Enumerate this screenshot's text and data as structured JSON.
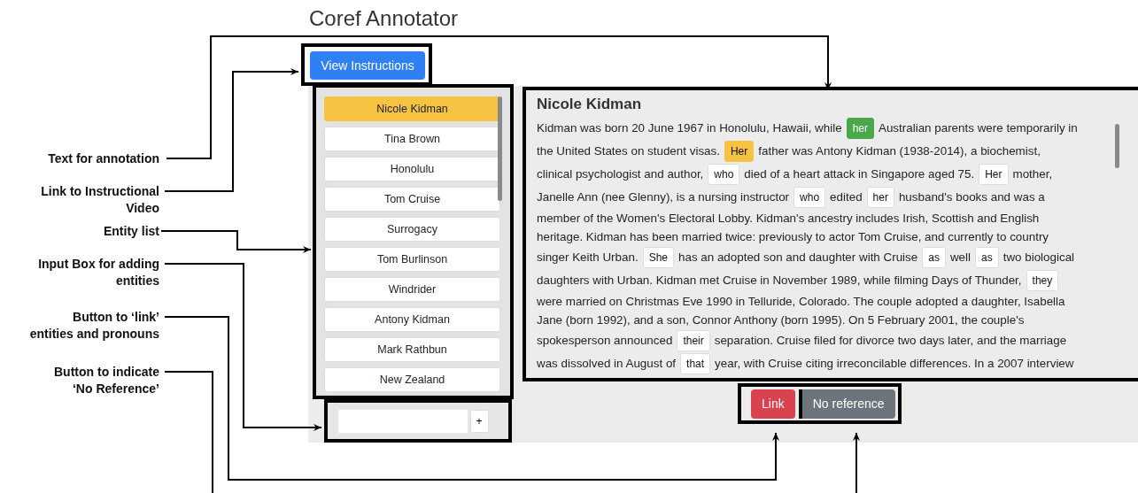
{
  "title": "Coref Annotator",
  "instructions_button": "View Instructions",
  "entities": [
    {
      "name": "Nicole Kidman",
      "selected": true
    },
    {
      "name": "Tina Brown",
      "selected": false
    },
    {
      "name": "Honolulu",
      "selected": false
    },
    {
      "name": "Tom Cruise",
      "selected": false
    },
    {
      "name": "Surrogacy",
      "selected": false
    },
    {
      "name": "Tom Burlinson",
      "selected": false
    },
    {
      "name": "Windrider",
      "selected": false
    },
    {
      "name": "Antony Kidman",
      "selected": false
    },
    {
      "name": "Mark Rathbun",
      "selected": false
    },
    {
      "name": "New Zealand",
      "selected": false
    }
  ],
  "add_entity": {
    "button": "+"
  },
  "passage": {
    "heading": "Nicole Kidman",
    "lines": [
      [
        {
          "kind": "text",
          "text": "Kidman was born 20 June 1967 in Honolulu, Hawaii, while"
        },
        {
          "kind": "token",
          "text": "her",
          "linked": true,
          "selected": false
        },
        {
          "kind": "text",
          "text": "Australian parents were temporarily in"
        }
      ],
      [
        {
          "kind": "text",
          "text": "the United States on student visas."
        },
        {
          "kind": "token",
          "text": "Her",
          "linked": false,
          "selected": true
        },
        {
          "kind": "text",
          "text": "father was Antony Kidman (1938-2014), a biochemist,"
        }
      ],
      [
        {
          "kind": "text",
          "text": "clinical psychologist and author,"
        },
        {
          "kind": "token",
          "text": "who",
          "linked": false,
          "selected": false
        },
        {
          "kind": "text",
          "text": "died of a heart attack in Singapore aged 75."
        },
        {
          "kind": "token",
          "text": "Her",
          "linked": false,
          "selected": false
        },
        {
          "kind": "text",
          "text": "mother,"
        }
      ],
      [
        {
          "kind": "text",
          "text": "Janelle Ann (nee Glenny), is a nursing instructor"
        },
        {
          "kind": "token",
          "text": "who",
          "linked": false,
          "selected": false
        },
        {
          "kind": "text",
          "text": "edited"
        },
        {
          "kind": "token",
          "text": "her",
          "linked": false,
          "selected": false
        },
        {
          "kind": "text",
          "text": "husband's books and was a"
        }
      ],
      [
        {
          "kind": "text",
          "text": "member of the Women's Electoral Lobby. Kidman's ancestry includes Irish, Scottish and English"
        }
      ],
      [
        {
          "kind": "text",
          "text": "heritage. Kidman has been married twice: previously to actor Tom Cruise, and currently to country"
        }
      ],
      [
        {
          "kind": "text",
          "text": "singer Keith Urban."
        },
        {
          "kind": "token",
          "text": "She",
          "linked": false,
          "selected": false
        },
        {
          "kind": "text",
          "text": "has an adopted son and daughter with Cruise"
        },
        {
          "kind": "token",
          "text": "as",
          "linked": false,
          "selected": false
        },
        {
          "kind": "text",
          "text": "well"
        },
        {
          "kind": "token",
          "text": "as",
          "linked": false,
          "selected": false
        },
        {
          "kind": "text",
          "text": "two biological"
        }
      ],
      [
        {
          "kind": "text",
          "text": "daughters with Urban. Kidman met Cruise in November 1989, while filming Days of Thunder,"
        },
        {
          "kind": "token",
          "text": "they",
          "linked": false,
          "selected": false
        }
      ],
      [
        {
          "kind": "text",
          "text": "were married on Christmas Eve 1990 in Telluride, Colorado. The couple adopted a daughter, Isabella"
        }
      ],
      [
        {
          "kind": "text",
          "text": "Jane (born 1992), and a son, Connor Anthony (born 1995). On 5 February 2001, the couple's"
        }
      ],
      [
        {
          "kind": "text",
          "text": "spokesperson announced"
        },
        {
          "kind": "token",
          "text": "their",
          "linked": false,
          "selected": false
        },
        {
          "kind": "text",
          "text": "separation. Cruise filed for divorce two days later, and the marriage"
        }
      ],
      [
        {
          "kind": "text",
          "text": "was dissolved in August of"
        },
        {
          "kind": "token",
          "text": "that",
          "linked": false,
          "selected": false
        },
        {
          "kind": "text",
          "text": "year, with Cruise citing irreconcilable differences. In a 2007 interview"
        }
      ]
    ]
  },
  "actions": [
    {
      "kind": "link",
      "label": "Link"
    },
    {
      "kind": "no_reference",
      "label": "No reference"
    }
  ],
  "callouts": [
    {
      "lines": [
        "Text for annotation"
      ]
    },
    {
      "lines": [
        "Link to Instructional",
        "Video"
      ]
    },
    {
      "lines": [
        "Entity list"
      ]
    },
    {
      "lines": [
        "Input Box for adding",
        "entities"
      ]
    },
    {
      "lines": [
        "Button to ‘link’",
        "entities and pronouns"
      ]
    },
    {
      "lines": [
        "Button to indicate",
        "‘No Reference’"
      ]
    }
  ]
}
